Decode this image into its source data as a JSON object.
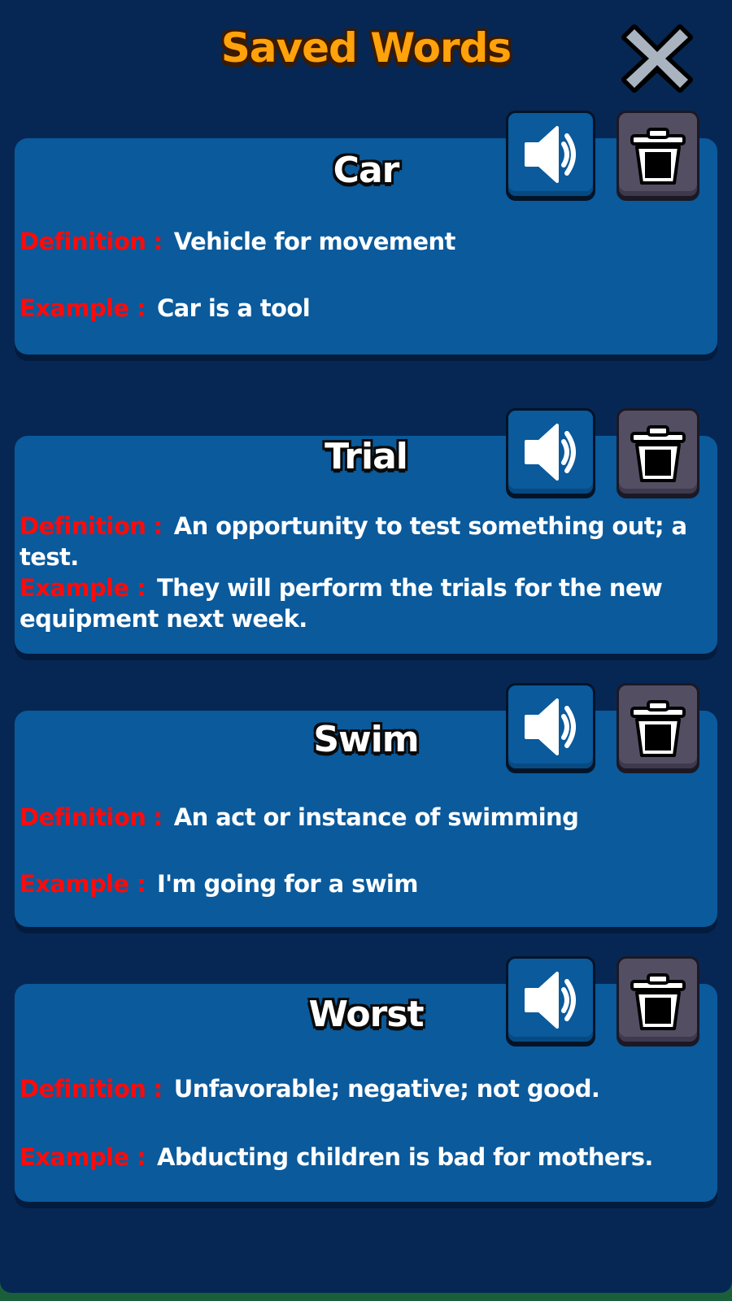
{
  "header": {
    "title": "Saved Words"
  },
  "labels": {
    "definition": "Definition :",
    "example": "Example :"
  },
  "words": [
    {
      "word": "Car",
      "definition": "Vehicle for movement",
      "example": "Car is a tool"
    },
    {
      "word": "Trial",
      "definition": "An opportunity to test something out; a test.",
      "example": "They will perform the trials for the new equipment next week."
    },
    {
      "word": "Swim",
      "definition": "An act or instance of swimming",
      "example": "I'm going for a swim"
    },
    {
      "word": "Worst",
      "definition": "Unfavorable; negative; not good.",
      "example": "Abducting children is bad for mothers."
    }
  ],
  "colors": {
    "background": "#062754",
    "card": "#0a5a9c",
    "title": "#ffa20c",
    "label": "#ff0a0a",
    "trash_button": "#544e63"
  },
  "icons": {
    "close": "close-icon",
    "speaker": "speaker-icon",
    "trash": "trash-icon"
  }
}
